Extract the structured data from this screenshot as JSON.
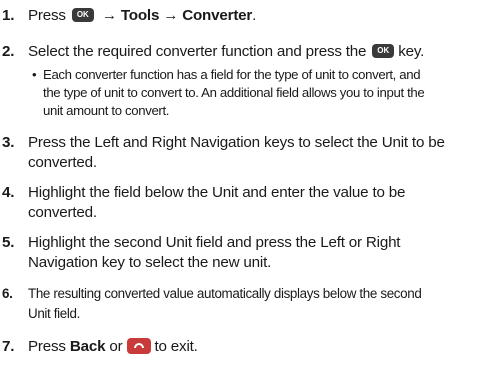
{
  "steps": [
    {
      "num": "1.",
      "prefix": "Press",
      "arrow1": "→",
      "menu1": "Tools",
      "arrow2": "→",
      "menu2": "Converter",
      "suffix": ".",
      "key_label": "OK"
    },
    {
      "num": "2.",
      "text_before": "Select the required converter function and press the",
      "text_after": "key.",
      "key_label": "OK",
      "bullet": {
        "dot": "•",
        "lines": [
          "Each converter function has a field for the type of unit to convert, and",
          "the type of unit to convert to. An additional field allows you to input the",
          "unit amount to convert."
        ]
      }
    },
    {
      "num": "3.",
      "lines": [
        "Press the Left and Right Navigation keys to select the Unit to be",
        "converted."
      ]
    },
    {
      "num": "4.",
      "lines": [
        "Highlight the field below the Unit and enter the value to be",
        "converted."
      ]
    },
    {
      "num": "5.",
      "lines": [
        "Highlight the second Unit field and press the Left or Right",
        "Navigation key to select the new unit."
      ]
    },
    {
      "num": "6.",
      "lines": [
        "The resulting converted value automatically displays below the second",
        "Unit field."
      ]
    },
    {
      "num": "7.",
      "prefix": "Press",
      "back": "Back",
      "or": "or",
      "suffix": "to exit.",
      "key_icon": "end-call-key-icon"
    }
  ],
  "colors": {
    "text": "#1a1a1a",
    "ok_key": "#3a3a3a",
    "end_key": "#c93a3a"
  }
}
